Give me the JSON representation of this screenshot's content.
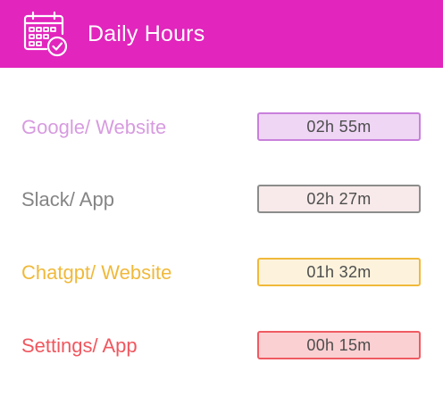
{
  "header": {
    "title": "Daily Hours",
    "icon": "calendar-check-icon",
    "background": "#e225bd"
  },
  "rows": [
    {
      "label": "Google/ Website",
      "duration": "02h 55m",
      "label_color": "#d79be0",
      "badge_bg": "#efd6f5",
      "badge_border": "#c880db"
    },
    {
      "label": "Slack/ App",
      "duration": "02h 27m",
      "label_color": "#858585",
      "badge_bg": "#f8eaea",
      "badge_border": "#8c8c8c"
    },
    {
      "label": "Chatgpt/ Website",
      "duration": "01h 32m",
      "label_color": "#f0b93a",
      "badge_bg": "#fdf3dd",
      "badge_border": "#f0b93a"
    },
    {
      "label": "Settings/ App",
      "duration": "00h 15m",
      "label_color": "#f0575f",
      "badge_bg": "#fbd0d2",
      "badge_border": "#ef5a62"
    }
  ]
}
